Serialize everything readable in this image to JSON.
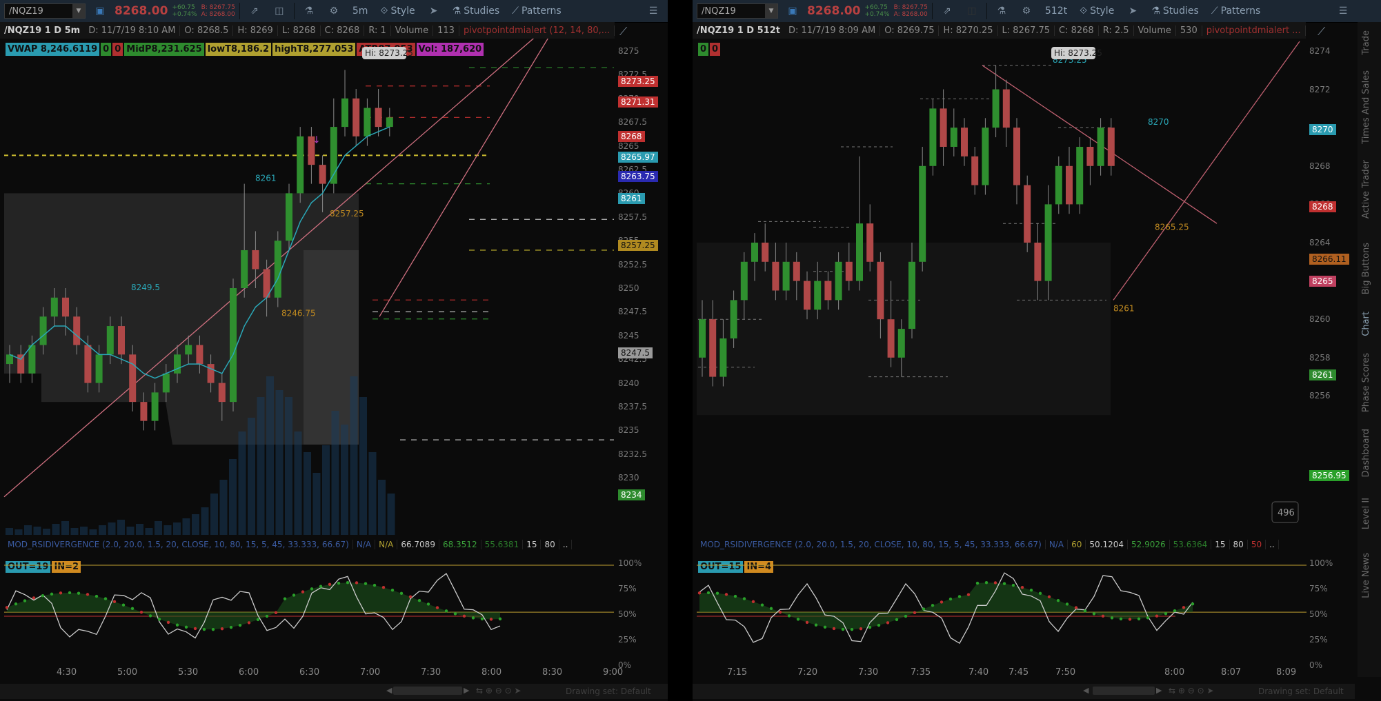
{
  "left": {
    "symbol": "/NQZ19",
    "last": "8268.00",
    "chg_pts": "+60.75",
    "chg_pct": "+0.74%",
    "bid": "B: 8267.75",
    "ask": "A: 8268.00",
    "timeframe": "5m",
    "style_label": "Style",
    "studies_label": "Studies",
    "patterns_label": "Patterns",
    "info": {
      "title": "/NQZ19 1 D 5m",
      "date": "D: 11/7/19 8:10 AM",
      "open": "O: 8268.5",
      "high": "H: 8269",
      "low": "L: 8268",
      "close": "C: 8268",
      "range": "R: 1",
      "volume_label": "Volume",
      "volume": "113",
      "alert": "pivotpointdmialert (12, 14, 80,..."
    },
    "studies": [
      {
        "text": "VWAP 8,246.6119",
        "bg": "#2a9bb0"
      },
      {
        "text": "0",
        "bg": "#2e8b2e"
      },
      {
        "text": "0",
        "bg": "#b03030"
      },
      {
        "text": "MidP8,231.625",
        "bg": "#2e8b2e"
      },
      {
        "text": "lowT8,186.2",
        "bg": "#b0a030"
      },
      {
        "text": "highT8,277.053",
        "bg": "#b0a030"
      },
      {
        "text": "ATR87.053",
        "bg": "#b03030"
      },
      {
        "text": "Vol: 187,620",
        "bg": "#b030b0"
      }
    ],
    "hi_label": "Hi: 8273.25",
    "price_ticks": [
      "8275",
      "8272.5",
      "8270",
      "8267.5",
      "8265",
      "8262.5",
      "8260",
      "8257.5",
      "8255",
      "8252.5",
      "8250",
      "8247.5",
      "8245",
      "8242.5",
      "8240",
      "8237.5",
      "8235",
      "8232.5",
      "8230"
    ],
    "price_tags": [
      {
        "text": "8273.25",
        "bg": "#c03030",
        "color": "#fff"
      },
      {
        "text": "8271.31",
        "bg": "#c03030",
        "color": "#fff"
      },
      {
        "text": "8268",
        "bg": "#c03030",
        "color": "#fff"
      },
      {
        "text": "8265.97",
        "bg": "#2a9bb0",
        "color": "#fff"
      },
      {
        "text": "8263.75",
        "bg": "#2a2ab0",
        "color": "#fff"
      },
      {
        "text": "8261",
        "bg": "#2a9bb0",
        "color": "#fff"
      },
      {
        "text": "8257.25",
        "bg": "#b08a20",
        "color": "#111"
      },
      {
        "text": "8247.5",
        "bg": "#9a9a9a",
        "color": "#111"
      },
      {
        "text": "8234",
        "bg": "#2e8b2e",
        "color": "#fff"
      }
    ],
    "annotations": [
      "8261",
      "8249.5",
      "8257.25",
      "8246.75"
    ],
    "osc": {
      "label": "MOD_RSIDIVERGENCE (2.0, 20.0, 1.5, 20, CLOSE, 10, 80, 15, 5, 45, 33.333, 66.67)",
      "na": "N/A",
      "na2": "N/A",
      "v1": "66.7089",
      "v2": "68.3512",
      "v3": "55.6381",
      "v4": "15",
      "v5": "80",
      "more": "..",
      "out": "OUT=19",
      "in": "IN=2",
      "pct": [
        "100%",
        "75%",
        "50%",
        "25%",
        "0%"
      ]
    },
    "times": [
      "4:30",
      "5:00",
      "5:30",
      "6:00",
      "6:30",
      "7:00",
      "7:30",
      "8:00",
      "8:30",
      "9:00"
    ],
    "drawing_set": "Drawing set: Default"
  },
  "right": {
    "symbol": "/NQZ19",
    "last": "8268.00",
    "chg_pts": "+60.75",
    "chg_pct": "+0.74%",
    "bid": "B: 8267.75",
    "ask": "A: 8268.00",
    "timeframe": "512t",
    "style_label": "Style",
    "studies_label": "Studies",
    "patterns_label": "Patterns",
    "info": {
      "title": "/NQZ19 1 D 512t",
      "date": "D: 11/7/19 8:09 AM",
      "open": "O: 8269.75",
      "high": "H: 8270.25",
      "low": "L: 8267.75",
      "close": "C: 8268",
      "range": "R: 2.5",
      "volume_label": "Volume",
      "volume": "530",
      "alert": "pivotpointdmialert ..."
    },
    "studies": [
      {
        "text": "0",
        "bg": "#2e8b2e"
      },
      {
        "text": "0",
        "bg": "#b03030"
      }
    ],
    "hi_label": "Hi: 8273.25",
    "price_ticks": [
      "8274",
      "8272",
      "8270",
      "8268",
      "8266",
      "8264",
      "8262",
      "8260",
      "8258",
      "8256"
    ],
    "price_tags": [
      {
        "text": "8270",
        "bg": "#2a9bb0",
        "color": "#fff"
      },
      {
        "text": "8268",
        "bg": "#c03030",
        "color": "#fff"
      },
      {
        "text": "8266.11",
        "bg": "#b06020",
        "color": "#111"
      },
      {
        "text": "8265",
        "bg": "#c04060",
        "color": "#fff"
      },
      {
        "text": "8261",
        "bg": "#2e8b2e",
        "color": "#fff"
      },
      {
        "text": "8256.95",
        "bg": "#2aa02a",
        "color": "#fff"
      }
    ],
    "annotations": [
      "8273.25",
      "8270",
      "8265.25",
      "8261"
    ],
    "bar_count": "496",
    "osc": {
      "label": "MOD_RSIDIVERGENCE (2.0, 20.0, 1.5, 20, CLOSE, 10, 80, 15, 5, 45, 33.333, 66.67)",
      "na": "N/A",
      "v0": "60",
      "v1": "50.1204",
      "v2": "52.9026",
      "v3": "53.6364",
      "v4": "15",
      "v5": "80",
      "v6": "50",
      "more": "..",
      "out": "OUT=15",
      "in": "IN=4",
      "pct": [
        "100%",
        "75%",
        "50%",
        "25%",
        "0%"
      ]
    },
    "times": [
      "7:15",
      "7:20",
      "7:30",
      "7:35",
      "7:40",
      "7:45",
      "7:50",
      "8:00",
      "8:07",
      "8:09"
    ],
    "drawing_set": "Drawing set: Default"
  },
  "sidebar_items": [
    "Trade",
    "Times And Sales",
    "Active Trader",
    "Big Buttons",
    "Chart",
    "Phase Scores",
    "Dashboard",
    "Level II",
    "Live News"
  ]
}
